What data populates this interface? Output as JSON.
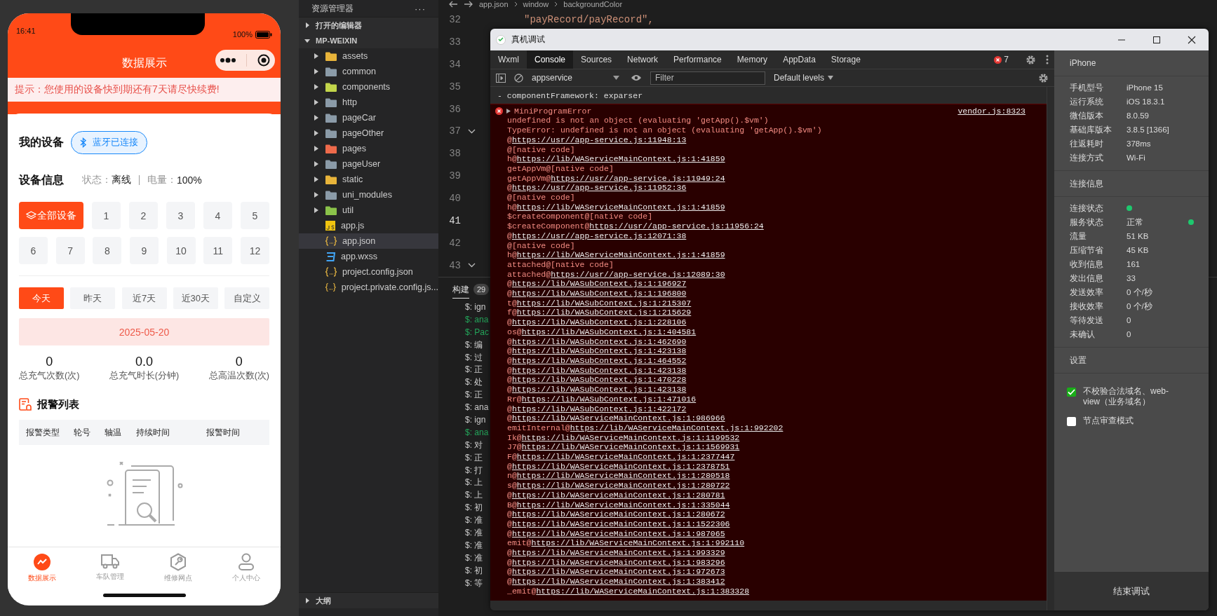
{
  "phone": {
    "status_bar": {
      "time": "16:41",
      "battery": "100%"
    },
    "nav_title": "数据展示",
    "notice": "提示：您使用的设备快到期还有7天请尽快续费!",
    "my_devices": {
      "title": "我的设备",
      "bluetooth": "蓝牙已连接"
    },
    "device_info": {
      "title": "设备信息",
      "status_label": "状态：",
      "status": "离线",
      "battery_label": "电量：",
      "battery": "100%"
    },
    "devices": [
      {
        "label": "全部设备",
        "kind": "all",
        "selected": true
      },
      {
        "label": "1",
        "kind": "number",
        "selected": false
      },
      {
        "label": "2",
        "kind": "number",
        "selected": false
      },
      {
        "label": "3",
        "kind": "number",
        "selected": false
      },
      {
        "label": "4",
        "kind": "number",
        "selected": false
      },
      {
        "label": "5",
        "kind": "number",
        "selected": false
      },
      {
        "label": "6",
        "kind": "number",
        "selected": false
      },
      {
        "label": "7",
        "kind": "number",
        "selected": false
      },
      {
        "label": "8",
        "kind": "number",
        "selected": false
      },
      {
        "label": "9",
        "kind": "number",
        "selected": false
      },
      {
        "label": "10",
        "kind": "number",
        "selected": false
      },
      {
        "label": "11",
        "kind": "number",
        "selected": false
      },
      {
        "label": "12",
        "kind": "number",
        "selected": false
      }
    ],
    "periods": [
      {
        "label": "今天",
        "selected": true
      },
      {
        "label": "昨天",
        "selected": false
      },
      {
        "label": "近7天",
        "selected": false
      },
      {
        "label": "近30天",
        "selected": false
      },
      {
        "label": "自定义",
        "selected": false
      }
    ],
    "date": "2025-05-20",
    "stats": [
      {
        "value": "0",
        "label": "总充气次数(次)"
      },
      {
        "value": "0.0",
        "label": "总充气时长(分钟)"
      },
      {
        "value": "0",
        "label": "总高温次数(次)"
      }
    ],
    "alarm": {
      "title": "报警列表",
      "columns": [
        "报警类型",
        "轮号",
        "轴温",
        "持续时间",
        "报警时间"
      ]
    },
    "tabbar": [
      {
        "label": "数据展示",
        "kind": "chart",
        "selected": true
      },
      {
        "label": "车队管理",
        "kind": "truck",
        "selected": false
      },
      {
        "label": "维修网点",
        "kind": "wrench",
        "selected": false
      },
      {
        "label": "个人中心",
        "kind": "user",
        "selected": false
      }
    ]
  },
  "explorer": {
    "title": "资源管理器",
    "more": "···",
    "open_editors": {
      "label": "打开的编辑器",
      "expanded": false
    },
    "project": {
      "label": "MP-WEIXIN",
      "expanded": true
    },
    "items": [
      {
        "name": "assets",
        "kind": "folder",
        "color": "#e8b43a",
        "selected": false
      },
      {
        "name": "common",
        "kind": "folder",
        "color": "#8b9ba8",
        "selected": false
      },
      {
        "name": "components",
        "kind": "folder",
        "color": "#c2d54a",
        "selected": false
      },
      {
        "name": "http",
        "kind": "folder",
        "color": "#8b9ba8",
        "selected": false
      },
      {
        "name": "pageCar",
        "kind": "folder",
        "color": "#8b9ba8",
        "selected": false
      },
      {
        "name": "pageOther",
        "kind": "folder",
        "color": "#8b9ba8",
        "selected": false
      },
      {
        "name": "pages",
        "kind": "folder",
        "color": "#ee6a4b",
        "selected": false
      },
      {
        "name": "pageUser",
        "kind": "folder",
        "color": "#8b9ba8",
        "selected": false
      },
      {
        "name": "static",
        "kind": "folder",
        "color": "#e8b43a",
        "selected": false
      },
      {
        "name": "uni_modules",
        "kind": "folder",
        "color": "#8b9ba8",
        "selected": false
      },
      {
        "name": "util",
        "kind": "folder",
        "color": "#8bc34a",
        "selected": false
      },
      {
        "name": "app.js",
        "kind": "js",
        "selected": false
      },
      {
        "name": "app.json",
        "kind": "json",
        "selected": true
      },
      {
        "name": "app.wxss",
        "kind": "css",
        "selected": false
      },
      {
        "name": "project.config.json",
        "kind": "json",
        "selected": false
      },
      {
        "name": "project.private.config.js...",
        "kind": "json",
        "selected": false
      }
    ],
    "outline": {
      "label": "大纲",
      "expanded": false
    }
  },
  "editor": {
    "breadcrumb": [
      "app.json",
      "window",
      "backgroundColor"
    ],
    "lines": [
      {
        "number": "32",
        "code": "\"payRecord/payRecord\",",
        "foldable": false,
        "current": false
      },
      {
        "number": "33",
        "foldable": false,
        "current": false
      },
      {
        "number": "34",
        "foldable": false,
        "current": false
      },
      {
        "number": "35",
        "foldable": false,
        "current": false
      },
      {
        "number": "36",
        "foldable": false,
        "current": false
      },
      {
        "number": "37",
        "foldable": true,
        "current": false
      },
      {
        "number": "38",
        "foldable": false,
        "current": false
      },
      {
        "number": "39",
        "foldable": false,
        "current": false
      },
      {
        "number": "40",
        "foldable": false,
        "current": false
      },
      {
        "number": "41",
        "foldable": false,
        "current": true
      },
      {
        "number": "42",
        "foldable": false,
        "current": false
      },
      {
        "number": "43",
        "foldable": true,
        "current": false
      }
    ]
  },
  "build": {
    "tab": "构建",
    "count": "29",
    "lines": [
      {
        "text": "$: ign",
        "kind": "info"
      },
      {
        "text": "$: ana",
        "kind": "success"
      },
      {
        "text": "$: Pac",
        "kind": "success"
      },
      {
        "text": "$: 编",
        "kind": "info"
      },
      {
        "text": "$: 过",
        "kind": "info"
      },
      {
        "text": "$: 正",
        "kind": "info"
      },
      {
        "text": "$: 处",
        "kind": "info"
      },
      {
        "text": "$: 正",
        "kind": "info"
      },
      {
        "text": "$: ana",
        "kind": "info"
      },
      {
        "text": "$: ign",
        "kind": "info"
      },
      {
        "text": "$: ana",
        "kind": "success"
      },
      {
        "text": "$: 对",
        "kind": "info"
      },
      {
        "text": "$: 正",
        "kind": "info"
      },
      {
        "text": "$: 打",
        "kind": "info"
      },
      {
        "text": "$: 上",
        "kind": "info"
      },
      {
        "text": "$: 上",
        "kind": "info"
      },
      {
        "text": "$: 初",
        "kind": "info"
      },
      {
        "text": "$: 准",
        "kind": "info"
      },
      {
        "text": "$: 准",
        "kind": "info"
      },
      {
        "text": "$: 准",
        "kind": "info"
      },
      {
        "text": "$: 准",
        "kind": "info"
      },
      {
        "text": "$: 初",
        "kind": "info"
      },
      {
        "text": "$: 等",
        "kind": "info"
      }
    ]
  },
  "debugger": {
    "title": "真机调试",
    "tabs": [
      {
        "label": "Wxml",
        "selected": false
      },
      {
        "label": "Console",
        "selected": true
      },
      {
        "label": "Sources",
        "selected": false
      },
      {
        "label": "Network",
        "selected": false
      },
      {
        "label": "Performance",
        "selected": false
      },
      {
        "label": "Memory",
        "selected": false
      },
      {
        "label": "AppData",
        "selected": false
      },
      {
        "label": "Storage",
        "selected": false
      }
    ],
    "error_count": "7",
    "context": "appservice",
    "filter_placeholder": "Filter",
    "levels": "Default levels",
    "log": [
      "- componentFramework: exparser"
    ],
    "error": {
      "title": "MiniProgramError",
      "source": "vendor.js:8323",
      "messages": [
        "undefined is not an object (evaluating 'getApp().$vm')",
        "TypeError: undefined is not an object (evaluating 'getApp().$vm')"
      ],
      "stack": [
        {
          "prefix": "@",
          "link": "https://usr//app-service.js:11948:13"
        },
        {
          "prefix": "@[native code]"
        },
        {
          "prefix": "h@",
          "link": "https://lib/WAServiceMainContext.js:1:41859"
        },
        {
          "prefix": "getAppVm@[native code]"
        },
        {
          "prefix": "getAppVm@",
          "link": "https://usr//app-service.js:11949:24"
        },
        {
          "prefix": "@",
          "link": "https://usr//app-service.js:11952:36"
        },
        {
          "prefix": "@[native code]"
        },
        {
          "prefix": "h@",
          "link": "https://lib/WAServiceMainContext.js:1:41859"
        },
        {
          "prefix": "$createComponent@[native code]"
        },
        {
          "prefix": "$createComponent@",
          "link": "https://usr//app-service.js:11956:24"
        },
        {
          "prefix": "@",
          "link": "https://usr//app-service.js:12071:38"
        },
        {
          "prefix": "@[native code]"
        },
        {
          "prefix": "h@",
          "link": "https://lib/WAServiceMainContext.js:1:41859"
        },
        {
          "prefix": "attached@[native code]"
        },
        {
          "prefix": "attached@",
          "link": "https://usr//app-service.js:12089:30"
        },
        {
          "prefix": "@",
          "link": "https://lib/WASubContext.js:1:196927"
        },
        {
          "prefix": "@",
          "link": "https://lib/WASubContext.js:1:196800"
        },
        {
          "prefix": "t@",
          "link": "https://lib/WASubContext.js:1:215307"
        },
        {
          "prefix": "f@",
          "link": "https://lib/WASubContext.js:1:215629"
        },
        {
          "prefix": "@",
          "link": "https://lib/WASubContext.js:1:228106"
        },
        {
          "prefix": "os@",
          "link": "https://lib/WASubContext.js:1:404581"
        },
        {
          "prefix": "@",
          "link": "https://lib/WASubContext.js:1:462690"
        },
        {
          "prefix": "@",
          "link": "https://lib/WASubContext.js:1:423138"
        },
        {
          "prefix": "@",
          "link": "https://lib/WASubContext.js:1:464552"
        },
        {
          "prefix": "@",
          "link": "https://lib/WASubContext.js:1:423138"
        },
        {
          "prefix": "@",
          "link": "https://lib/WASubContext.js:1:470228"
        },
        {
          "prefix": "@",
          "link": "https://lib/WASubContext.js:1:423138"
        },
        {
          "prefix": "Rr@",
          "link": "https://lib/WASubContext.js:1:471016"
        },
        {
          "prefix": "@",
          "link": "https://lib/WASubContext.js:1:422172"
        },
        {
          "prefix": "@",
          "link": "https://lib/WAServiceMainContext.js:1:986966"
        },
        {
          "prefix": "emitInternal@",
          "link": "https://lib/WAServiceMainContext.js:1:992202"
        },
        {
          "prefix": "Ik@",
          "link": "https://lib/WAServiceMainContext.js:1:1199532"
        },
        {
          "prefix": "J7@",
          "link": "https://lib/WAServiceMainContext.js:1:1569931"
        },
        {
          "prefix": "F@",
          "link": "https://lib/WAServiceMainContext.js:1:2377447"
        },
        {
          "prefix": "@",
          "link": "https://lib/WAServiceMainContext.js:1:2378751"
        },
        {
          "prefix": "n@",
          "link": "https://lib/WAServiceMainContext.js:1:280518"
        },
        {
          "prefix": "s@",
          "link": "https://lib/WAServiceMainContext.js:1:280722"
        },
        {
          "prefix": "@",
          "link": "https://lib/WAServiceMainContext.js:1:280781"
        },
        {
          "prefix": "B@",
          "link": "https://lib/WAServiceMainContext.js:1:335044"
        },
        {
          "prefix": "@",
          "link": "https://lib/WAServiceMainContext.js:1:280672"
        },
        {
          "prefix": "@",
          "link": "https://lib/WAServiceMainContext.js:1:1522306"
        },
        {
          "prefix": "@",
          "link": "https://lib/WAServiceMainContext.js:1:987065"
        },
        {
          "prefix": "emit@",
          "link": "https://lib/WAServiceMainContext.js:1:992110"
        },
        {
          "prefix": "@",
          "link": "https://lib/WAServiceMainContext.js:1:993329"
        },
        {
          "prefix": "@",
          "link": "https://lib/WAServiceMainContext.js:1:983296"
        },
        {
          "prefix": "@",
          "link": "https://lib/WAServiceMainContext.js:1:972673"
        },
        {
          "prefix": "@",
          "link": "https://lib/WAServiceMainContext.js:1:383412"
        },
        {
          "prefix": "_emit@",
          "link": "https://lib/WAServiceMainContext.js:1:383328"
        }
      ]
    },
    "device_panel": {
      "title": "iPhone",
      "info": [
        {
          "label": "手机型号",
          "value": "iPhone 15"
        },
        {
          "label": "运行系统",
          "value": "iOS 18.3.1"
        },
        {
          "label": "微信版本",
          "value": "8.0.59"
        },
        {
          "label": "基础库版本",
          "value": "3.8.5 [1366]"
        },
        {
          "label": "往返耗时",
          "value": "378ms"
        },
        {
          "label": "连接方式",
          "value": "Wi-Fi"
        }
      ],
      "connection_title": "连接信息",
      "connection": [
        {
          "label": "连接状态",
          "color": "#1ec86e"
        },
        {
          "label": "服务状态",
          "value": "正常",
          "color": "#1ec86e"
        },
        {
          "label": "流量",
          "value": "51 KB"
        },
        {
          "label": "压缩节省",
          "value": "45 KB"
        },
        {
          "label": "收到信息",
          "value": "161"
        },
        {
          "label": "发出信息",
          "value": "33"
        },
        {
          "label": "发送效率",
          "value": "0 个/秒"
        },
        {
          "label": "接收效率",
          "value": "0 个/秒"
        },
        {
          "label": "等待发送",
          "value": "0"
        },
        {
          "label": "未确认",
          "value": "0"
        }
      ],
      "settings_title": "设置",
      "settings": [
        {
          "label": "不校验合法域名、web-view（业务域名）",
          "checked": true
        },
        {
          "label": "节点审查模式",
          "checked": false
        }
      ],
      "end_button": "结束调试"
    }
  }
}
